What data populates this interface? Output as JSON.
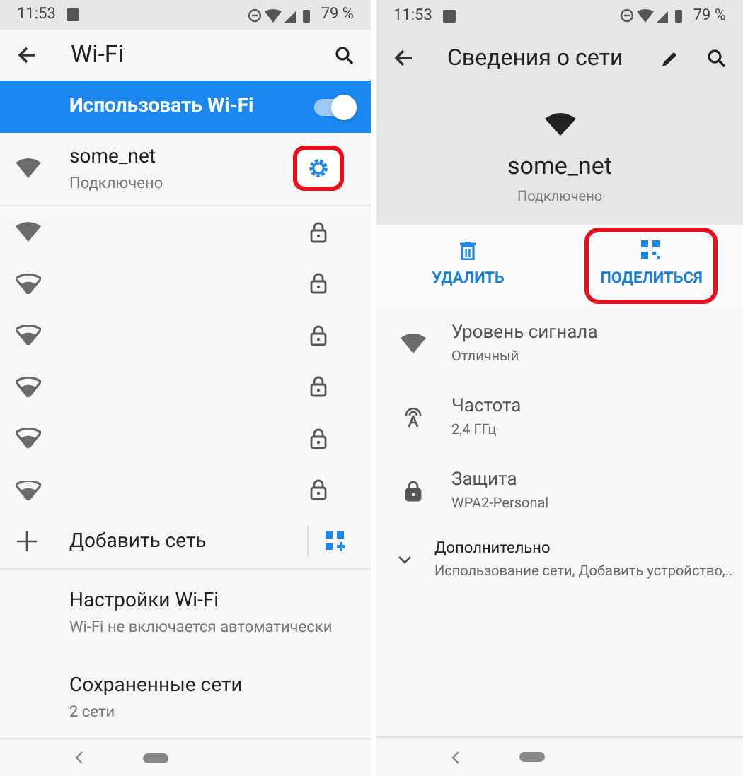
{
  "left": {
    "status_bar": {
      "time": "11:53",
      "battery": "79 %"
    },
    "app_bar": {
      "title": "Wi-Fi"
    },
    "wifi_toggle": {
      "label": "Использовать Wi-Fi",
      "on": true
    },
    "networks": [
      {
        "name": "some_net",
        "status": "Подключено",
        "kind": "connected",
        "highlighted": true
      },
      {
        "kind": "secured_strong",
        "highlighted": false
      },
      {
        "kind": "secured_weak",
        "highlighted": false
      },
      {
        "kind": "secured_weak",
        "highlighted": false
      },
      {
        "kind": "secured_weak",
        "highlighted": false
      },
      {
        "kind": "secured_weak",
        "highlighted": false
      },
      {
        "kind": "secured_weak",
        "highlighted": false
      }
    ],
    "add_network": {
      "label": "Добавить сеть"
    },
    "settings": [
      {
        "title": "Настройки Wi-Fi",
        "subtitle": "Wi-Fi не включается автоматически"
      },
      {
        "title": "Сохраненные сети",
        "subtitle": "2 сети"
      }
    ]
  },
  "right": {
    "status_bar": {
      "time": "11:53",
      "battery": "79 %"
    },
    "app_bar": {
      "title": "Сведения о сети"
    },
    "network": {
      "name": "some_net",
      "status": "Подключено"
    },
    "actions": [
      {
        "kind": "delete",
        "label": "УДАЛИТЬ",
        "highlighted": false
      },
      {
        "kind": "share",
        "label": "ПОДЕЛИТЬСЯ",
        "highlighted": true
      }
    ],
    "details": [
      {
        "kind": "signal",
        "title": "Уровень сигнала",
        "value": "Отличный"
      },
      {
        "kind": "frequency",
        "title": "Частота",
        "value": "2,4 ГГц"
      },
      {
        "kind": "security",
        "title": "Защита",
        "value": "WPA2-Personal"
      },
      {
        "kind": "advanced",
        "title": "Дополнительно",
        "value": "Использование сети, Добавить устройство,.."
      }
    ]
  }
}
